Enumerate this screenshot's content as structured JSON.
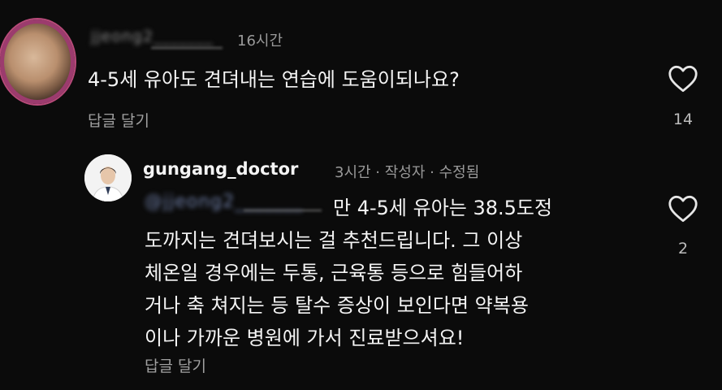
{
  "comment": {
    "username": "jjeong2_______",
    "time": "16시간",
    "text": "4-5세 유아도 견뎌내는 연습에 도움이되나요?",
    "reply_label": "답글 달기",
    "likes": "14"
  },
  "reply": {
    "username": "gungang_doctor",
    "meta": "3시간 · 작성자 · 수정됨",
    "mention": "@jjeong2_______",
    "lines": [
      "만 4-5세 유아는 38.5도정",
      "도까지는 견뎌보시는 걸 추천드립니다. 그 이상",
      "체온일 경우에는 두통, 근육통 등으로 힘들어하",
      "거나 축 쳐지는 등 탈수 증상이 보인다면 약복용",
      "이나 가까운 병원에 가서 진료받으셔요!"
    ],
    "reply_label": "답글 달기",
    "likes": "2"
  },
  "icons": {
    "like": "heart-outline-icon"
  },
  "colors": {
    "background": "#0b0b0b",
    "text": "#f4f4f4",
    "muted": "#9a9a9a",
    "avatar_ring": "#b84a7a"
  }
}
